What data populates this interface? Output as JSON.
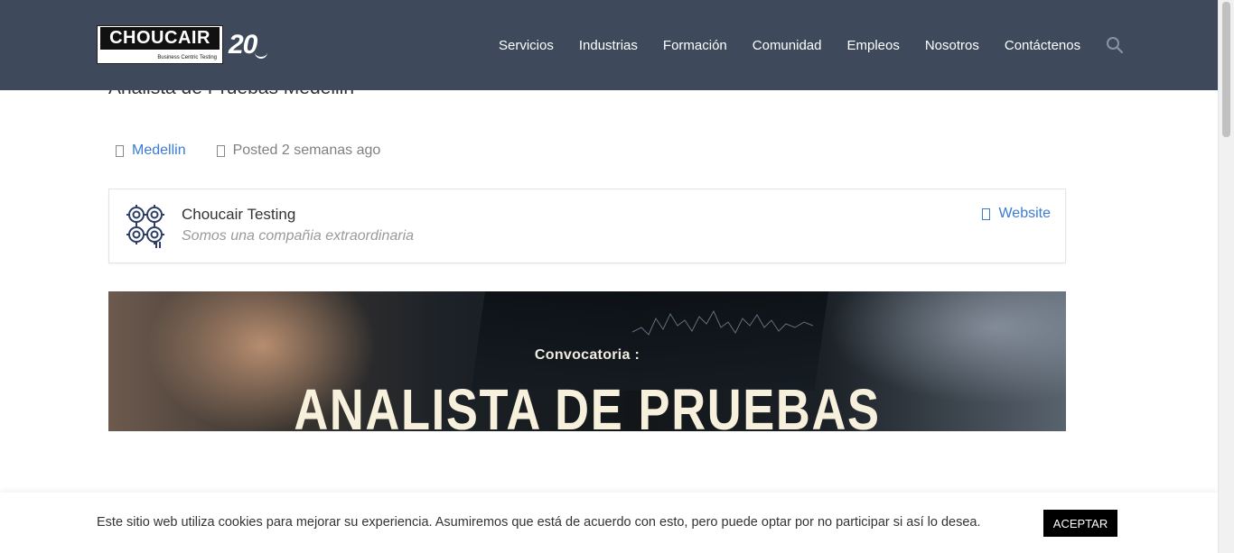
{
  "header": {
    "logo": {
      "wordmark": "CHOUCAIR",
      "tagline": "Business Centric Testing",
      "anniversary": "20"
    },
    "nav": [
      "Servicios",
      "Industrias",
      "Formación",
      "Comunidad",
      "Empleos",
      "Nosotros",
      "Contáctenos"
    ],
    "search_icon": "search-icon"
  },
  "job": {
    "title": "Analista de Pruebas Medellin",
    "location": "Medellin",
    "posted": "Posted 2 semanas ago"
  },
  "company": {
    "name": "Choucair Testing",
    "tagline": "Somos una compañia extraordinaria",
    "website_label": "Website",
    "logo_icon": "gears-icon"
  },
  "banner": {
    "subtitle": "Convocatoria :",
    "headline": "ANALISTA DE PRUEBAS"
  },
  "cookie": {
    "message": "Este sitio web utiliza cookies para mejorar su experiencia. Asumiremos que está de acuerdo con esto, pero puede optar por no participar si así lo desea.",
    "accept_label": "ACEPTAR"
  },
  "colors": {
    "header_bg": "#3e4a5c",
    "link": "#3a7bd5",
    "accept_bg": "#000000"
  }
}
